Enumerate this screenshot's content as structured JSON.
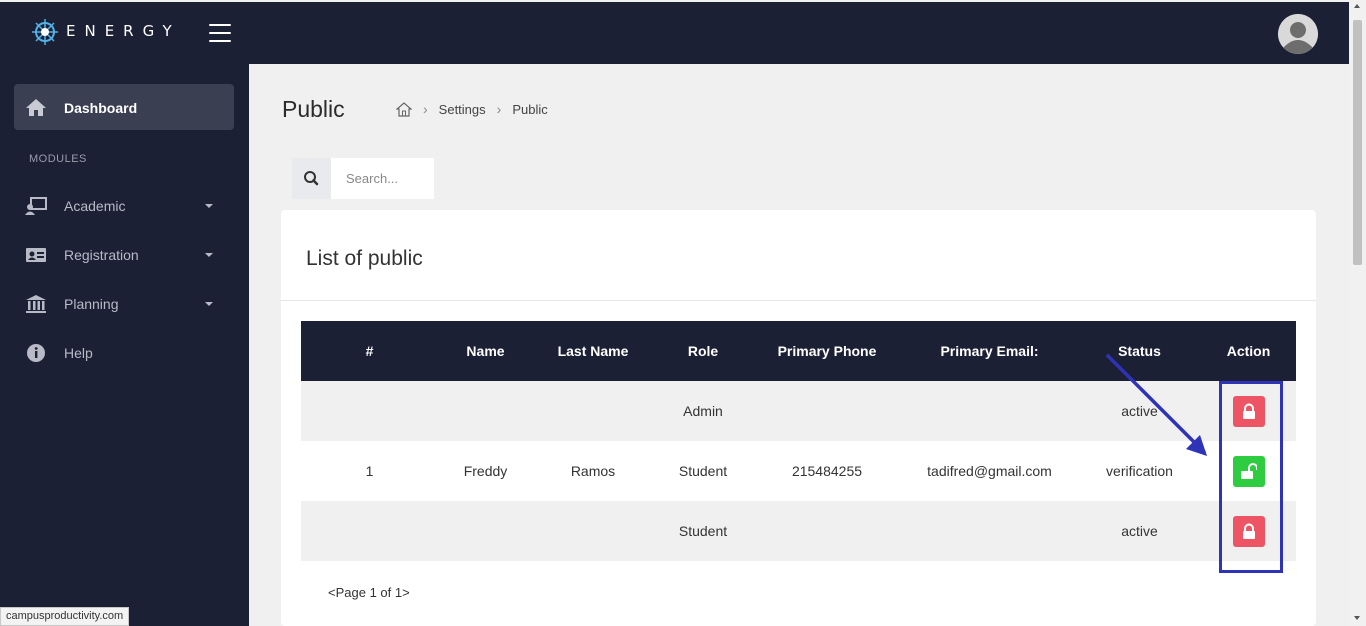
{
  "brand": {
    "name": "ENERGY"
  },
  "sidebar": {
    "active": {
      "label": "Dashboard",
      "icon": "home-icon"
    },
    "section_title": "MODULES",
    "items": [
      {
        "label": "Academic",
        "icon": "classroom-icon"
      },
      {
        "label": "Registration",
        "icon": "id-card-icon"
      },
      {
        "label": "Planning",
        "icon": "institution-icon"
      },
      {
        "label": "Help",
        "icon": "info-icon"
      }
    ]
  },
  "header": {
    "title": "Public",
    "breadcrumb": [
      "Settings",
      "Public"
    ]
  },
  "search": {
    "placeholder": "Search..."
  },
  "card": {
    "title": "List of public",
    "columns": [
      "#",
      "Name",
      "Last Name",
      "Role",
      "Primary Phone",
      "Primary Email:",
      "Status",
      "Action"
    ],
    "rows": [
      {
        "num": "",
        "name": "",
        "last_name": "",
        "role": "Admin",
        "phone": "",
        "email": "",
        "status": "active",
        "action": "lock"
      },
      {
        "num": "1",
        "name": "Freddy",
        "last_name": "Ramos",
        "role": "Student",
        "phone": "215484255",
        "email": "tadifred@gmail.com",
        "status": "verification",
        "action": "unlock"
      },
      {
        "num": "",
        "name": "",
        "last_name": "",
        "role": "Student",
        "phone": "",
        "email": "",
        "status": "active",
        "action": "lock"
      }
    ],
    "pager": "<Page 1 of 1>"
  },
  "status_bar": {
    "url": "campusproductivity.com"
  },
  "colors": {
    "sidebar_bg": "#1c2035",
    "lock_red": "#ed5565",
    "unlock_green": "#2ecc40",
    "annotation_blue": "#2f33b8"
  }
}
